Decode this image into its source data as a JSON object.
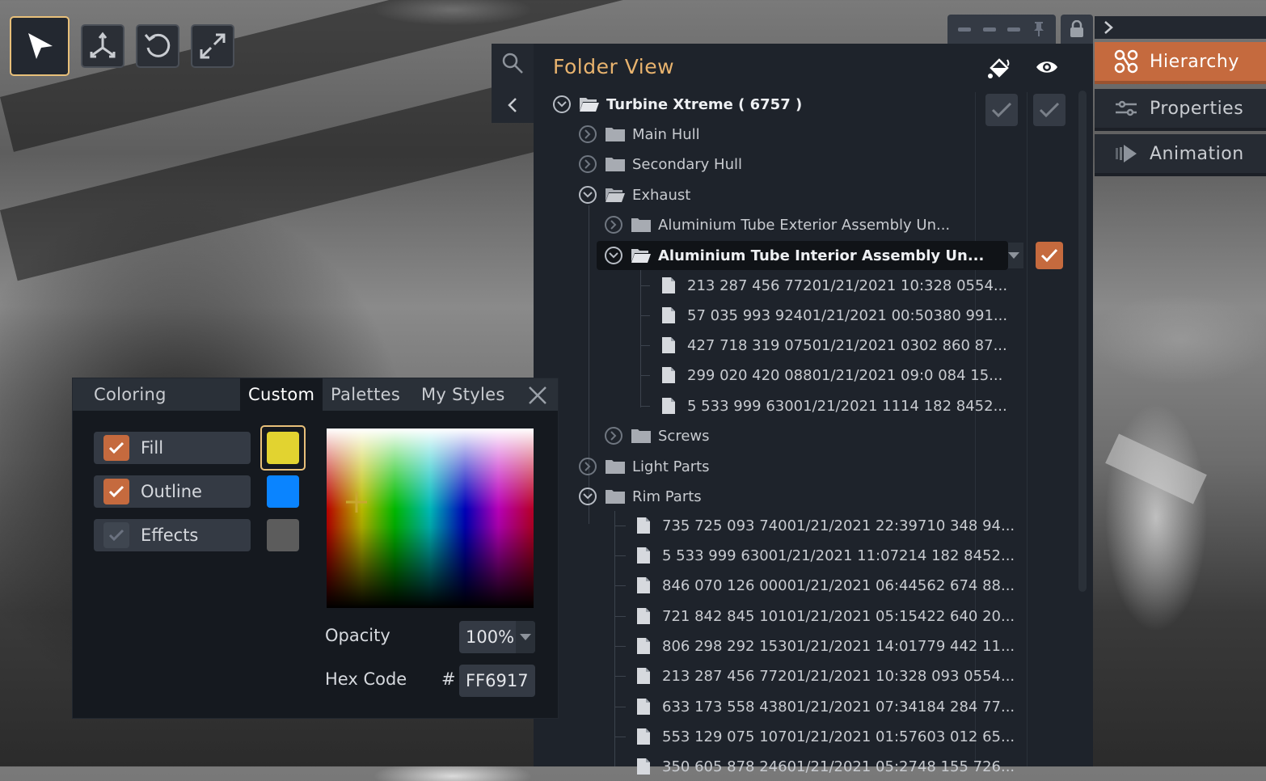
{
  "toolbar": {
    "tools": [
      {
        "name": "select-tool",
        "icon": "pointer-arrow-icon",
        "active": true
      },
      {
        "name": "axis-tool",
        "icon": "axis-move-icon",
        "active": false
      },
      {
        "name": "rotate-tool",
        "icon": "rotate-icon",
        "active": false
      },
      {
        "name": "scale-tool",
        "icon": "expand-icon",
        "active": false
      }
    ]
  },
  "right_tabs": [
    {
      "label": "Hierarchy",
      "icon": "hierarchy-icon",
      "active": true
    },
    {
      "label": "Properties",
      "icon": "sliders-icon",
      "active": false
    },
    {
      "label": "Animation",
      "icon": "animation-icon",
      "active": false
    }
  ],
  "folder_view": {
    "title": "Folder View",
    "header_icons": [
      "paint-bucket-icon",
      "eye-icon"
    ],
    "tree": [
      {
        "label": "Turbine Xtreme ( 6757 )",
        "type": "folder",
        "expanded": true,
        "bold": true
      },
      {
        "label": "Main Hull",
        "type": "folder",
        "expanded": false
      },
      {
        "label": "Secondary Hull",
        "type": "folder",
        "expanded": false
      },
      {
        "label": "Exhaust",
        "type": "folder",
        "expanded": true
      },
      {
        "label": "Aluminium Tube Exterior Assembly Un...",
        "type": "folder",
        "expanded": false
      },
      {
        "label": "Aluminium Tube Interior Assembly Un...",
        "type": "folder",
        "expanded": true,
        "bold": true,
        "selected": true
      },
      {
        "label": "213 287 456 77201/21/2021 10:328 0554...",
        "type": "file"
      },
      {
        "label": "57 035 993 92401/21/2021 00:50380 991...",
        "type": "file"
      },
      {
        "label": "427 718 319 07501/21/2021 0302 860 87...",
        "type": "file"
      },
      {
        "label": "299 020 420 08801/21/2021 09:0 084 15...",
        "type": "file"
      },
      {
        "label": "5 533 999 63001/21/2021 1114 182 8452...",
        "type": "file"
      },
      {
        "label": "Screws",
        "type": "folder",
        "expanded": false
      },
      {
        "label": "Light Parts",
        "type": "folder",
        "expanded": false
      },
      {
        "label": "Rim Parts",
        "type": "folder",
        "expanded": true
      },
      {
        "label": "735 725 093 74001/21/2021 22:39710 348 94...",
        "type": "file"
      },
      {
        "label": "5 533 999 63001/21/2021 11:07214 182 8452...",
        "type": "file"
      },
      {
        "label": "846 070 126 00001/21/2021 06:44562 674 88...",
        "type": "file"
      },
      {
        "label": "721 842 845 10101/21/2021 05:15422 640 20...",
        "type": "file"
      },
      {
        "label": "806 298 292 15301/21/2021 14:01779 442 11...",
        "type": "file"
      },
      {
        "label": "213 287 456 77201/21/2021 10:328 093 0554...",
        "type": "file"
      },
      {
        "label": "633 173 558 43801/21/2021 07:34184 284 77...",
        "type": "file"
      },
      {
        "label": "553 129 075 10701/21/2021 01:57603 012 65...",
        "type": "file"
      },
      {
        "label": "350 605 878 24601/21/2021 05:2748 155 726...",
        "type": "file"
      }
    ]
  },
  "coloring": {
    "title": "Coloring",
    "tabs": [
      "Custom",
      "Palettes",
      "My Styles"
    ],
    "active_tab": "Custom",
    "options": [
      {
        "label": "Fill",
        "checked": true,
        "swatch": "#e2d330"
      },
      {
        "label": "Outline",
        "checked": true,
        "swatch": "#0a84ff"
      },
      {
        "label": "Effects",
        "checked": false,
        "swatch": "#5c5c5c"
      }
    ],
    "opacity_label": "Opacity",
    "opacity_value": "100%",
    "hex_label": "Hex Code",
    "hex_prefix": "#",
    "hex_value": "FF6917"
  },
  "colors": {
    "accent": "#c56a3e",
    "title_gold": "#e8b36e",
    "check_blue": "#2f7bd8"
  }
}
